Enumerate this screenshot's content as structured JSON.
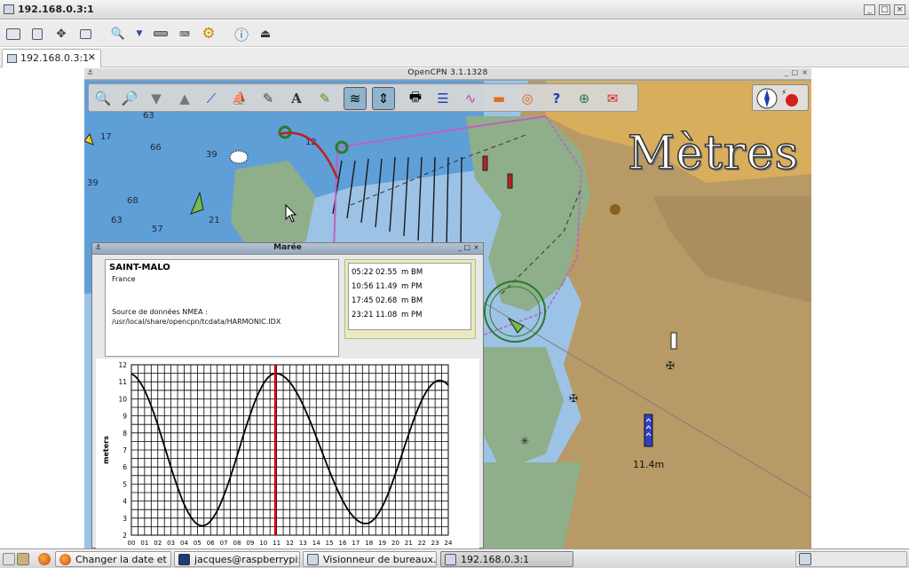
{
  "window": {
    "title": "192.168.0.3:1"
  },
  "viewer_toolbar": {
    "icons": [
      "fullscreen-icon",
      "fit-window-icon",
      "scale-icon",
      "windows-icon",
      "zoom-icon",
      "dropdown-icon",
      "keyboard-icon",
      "ctrl-alt-del-icon",
      "settings-icon",
      "info-icon",
      "disconnect-icon"
    ]
  },
  "tabs": [
    {
      "label": "192.168.0.3:1",
      "close": "✕"
    }
  ],
  "opencpn": {
    "title": "OpenCPN 3.1.1328",
    "units_label": "Mètres",
    "depth_marker_label": "11.4m",
    "soundings": [
      "63",
      "17",
      "66",
      "39",
      "39",
      "12",
      "68",
      "63",
      "21",
      "57"
    ],
    "tools": [
      "zoom-in-icon",
      "zoom-out-icon",
      "scale-in-icon",
      "scale-out-icon",
      "route-icon",
      "ship-icon",
      "measure-icon",
      "text-icon",
      "tide-icon",
      "current-icon",
      "print-icon",
      "route-manager-icon",
      "track-icon",
      "color-scheme-icon",
      "mob-icon",
      "help-icon",
      "ais-icon",
      "chart-info-icon"
    ],
    "compass": {
      "mode": "north-up"
    }
  },
  "tide_dialog": {
    "title": "Marée",
    "station": "SAINT-MALO",
    "country": "France",
    "source_label": "Source de données NMEA :",
    "source_path": "/usr/local/share/opencpn/tcdata/HARMONIC.IDX",
    "events": [
      {
        "time": "05:22",
        "height": "02.55",
        "unit": "m",
        "kind": "BM"
      },
      {
        "time": "10:56",
        "height": "11.49",
        "unit": "m",
        "kind": "PM"
      },
      {
        "time": "17:45",
        "height": "02.68",
        "unit": "m",
        "kind": "BM"
      },
      {
        "time": "23:21",
        "height": "11.08",
        "unit": "m",
        "kind": "PM"
      }
    ],
    "y_axis_label": "meters",
    "y_ticks": [
      "2",
      "3",
      "4",
      "5",
      "6",
      "7",
      "8",
      "9",
      "10",
      "11",
      "12"
    ],
    "x_ticks": [
      "00",
      "01",
      "02",
      "03",
      "04",
      "05",
      "06",
      "07",
      "08",
      "09",
      "10",
      "11",
      "12",
      "13",
      "14",
      "15",
      "16",
      "17",
      "18",
      "19",
      "20",
      "21",
      "22",
      "23",
      "24"
    ],
    "current_hour": 10.9,
    "curve_color": "#000000",
    "now_line_color": "#e00000"
  },
  "taskbar": {
    "items": [
      {
        "label": "Changer la date et l'h...",
        "icon": "firefox-icon"
      },
      {
        "label": "jacques@raspberrypi:...",
        "icon": "terminal-icon"
      },
      {
        "label": "Visionneur de bureaux...",
        "icon": "vnc-viewer-icon"
      },
      {
        "label": "192.168.0.3:1",
        "icon": "vnc-viewer-icon",
        "active": true
      }
    ]
  }
}
